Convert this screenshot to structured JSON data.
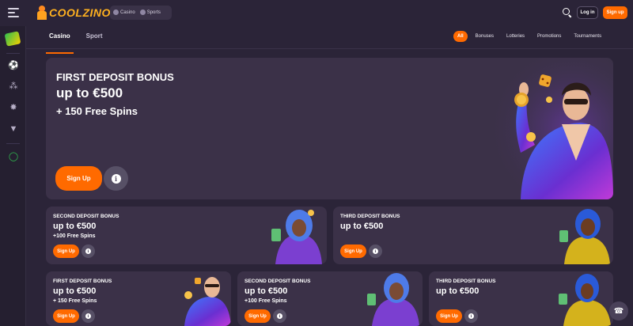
{
  "brand": {
    "name": "COOLZINO"
  },
  "header": {
    "mode_switch": {
      "casino": "Casino",
      "sports": "Sports"
    },
    "login": "Log in",
    "signup": "Sign up"
  },
  "tabs": [
    {
      "label": "Casino"
    },
    {
      "label": "Sport"
    }
  ],
  "filters": [
    {
      "label": "All"
    },
    {
      "label": "Bonuses"
    },
    {
      "label": "Lotteries"
    },
    {
      "label": "Promotions"
    },
    {
      "label": "Tournaments"
    }
  ],
  "hero": {
    "title": "FIRST DEPOSIT BONUS",
    "amount": "up to €500",
    "extra": "+ 150 Free Spins",
    "button": "Sign Up",
    "info_icon": "info-icon"
  },
  "cards": [
    {
      "title": "SECOND DEPOSIT BONUS",
      "amount": "up to €500",
      "extra": "+100 Free Spins",
      "button": "Sign Up"
    },
    {
      "title": "THIRD DEPOSIT BONUS",
      "amount": "up to €500",
      "extra": "",
      "button": "Sign Up"
    },
    {
      "title": "FIRST DEPOSIT BONUS",
      "amount": "up to €500",
      "extra": "+ 150 Free Spins",
      "button": "Sign Up"
    },
    {
      "title": "SECOND DEPOSIT BONUS",
      "amount": "up to €500",
      "extra": "+100 Free Spins",
      "button": "Sign Up"
    },
    {
      "title": "THIRD DEPOSIT BONUS",
      "amount": "up to €500",
      "extra": "",
      "button": "Sign Up"
    }
  ],
  "colors": {
    "accent": "#ff6a00",
    "background": "#2b2438",
    "card": "#3b3148"
  },
  "icons": [
    "menu-icon",
    "search-icon",
    "sport-icon",
    "basketball-icon",
    "live-icon",
    "soccer-icon",
    "gamepad-icon",
    "chat-icon",
    "support-icon"
  ]
}
